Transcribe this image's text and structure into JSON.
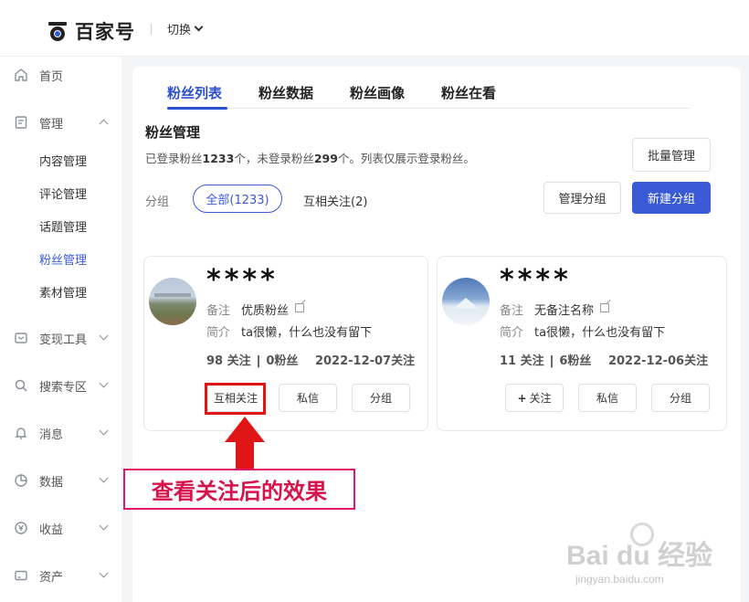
{
  "header": {
    "logo_text": "百家号",
    "switch_label": "切换"
  },
  "sidebar": {
    "items": [
      {
        "label": "首页",
        "icon": "home-icon"
      },
      {
        "label": "管理",
        "icon": "document-icon"
      },
      {
        "label": "变现工具",
        "icon": "wallet-icon"
      },
      {
        "label": "搜索专区",
        "icon": "search-icon"
      },
      {
        "label": "消息",
        "icon": "bell-icon"
      },
      {
        "label": "数据",
        "icon": "pie-chart-icon"
      },
      {
        "label": "收益",
        "icon": "yen-icon"
      },
      {
        "label": "资产",
        "icon": "card-icon"
      }
    ],
    "sub_items": [
      "内容管理",
      "评论管理",
      "话题管理",
      "粉丝管理",
      "素材管理"
    ],
    "active_sub": "粉丝管理"
  },
  "tabs": [
    "粉丝列表",
    "粉丝数据",
    "粉丝画像",
    "粉丝在看"
  ],
  "active_tab": "粉丝列表",
  "section": {
    "title": "粉丝管理",
    "summary_prefix": "已登录粉丝",
    "logged_in": "1233",
    "summary_mid": "个，未登录粉丝",
    "logged_out": "299",
    "summary_suffix": "个。列表仅展示登录粉丝。"
  },
  "buttons": {
    "batch": "批量管理",
    "manage_group": "管理分组",
    "new_group": "新建分组"
  },
  "filter": {
    "label": "分组",
    "all": "全部(1233)",
    "mutual": "互相关注(2)"
  },
  "fans": [
    {
      "name": "****",
      "remark_label": "备注",
      "remark": "优质粉丝",
      "bio_label": "简介",
      "bio": "ta很懒，什么也没有留下",
      "following": "98 关注",
      "followers": "0粉丝",
      "date": "2022-12-07关注",
      "follow_btn": "互相关注",
      "message_btn": "私信",
      "group_btn": "分组"
    },
    {
      "name": "****",
      "remark_label": "备注",
      "remark": "无备注名称",
      "bio_label": "简介",
      "bio": "ta很懒，什么也没有留下",
      "following": "11 关注",
      "followers": "6粉丝",
      "date": "2022-12-06关注",
      "follow_btn": "关注",
      "message_btn": "私信",
      "group_btn": "分组"
    }
  ],
  "annotation": {
    "callout": "查看关注后的效果",
    "color": "#e01515"
  },
  "watermark": {
    "line1": "Bai du 经验",
    "line2": "jingyan.baidu.com"
  },
  "colors": {
    "accent": "#3a5ad6"
  }
}
